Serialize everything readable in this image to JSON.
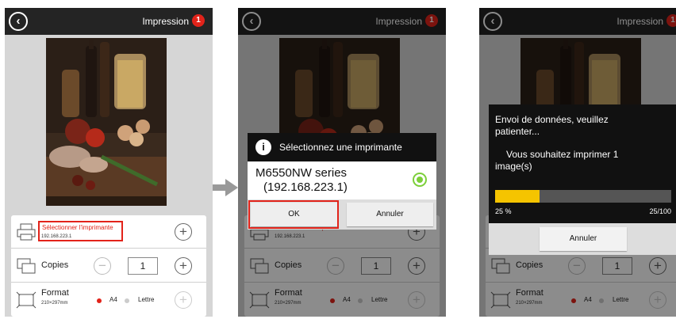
{
  "app": {
    "title": "Impression",
    "badge": "1"
  },
  "panel": {
    "printer_label": "Sélectionner l'imprimante",
    "printer_ip": "192.168.223.1",
    "copies_label": "Copies",
    "copies_value": "1",
    "format_label": "Format",
    "format_size": "210×297mm",
    "format_a4": "A4",
    "format_letter": "Lettre"
  },
  "select_dialog": {
    "title": "Sélectionnez une imprimante",
    "printer_name": "M6550NW series",
    "printer_ip": "(192.168.223.1)",
    "ok": "OK",
    "cancel": "Annuler"
  },
  "send_dialog": {
    "message_line1": "Envoi de données, veuillez patienter...",
    "message_line2": "Vous souhaitez imprimer 1 image(s)",
    "progress_percent": "25 %",
    "progress_count": "25/100",
    "progress_fraction": 0.25,
    "cancel": "Annuler"
  },
  "colors": {
    "accent_red": "#e2231a",
    "progress_yellow": "#f5c400",
    "topbar": "#242424",
    "radio_green": "#7ccf3a"
  }
}
